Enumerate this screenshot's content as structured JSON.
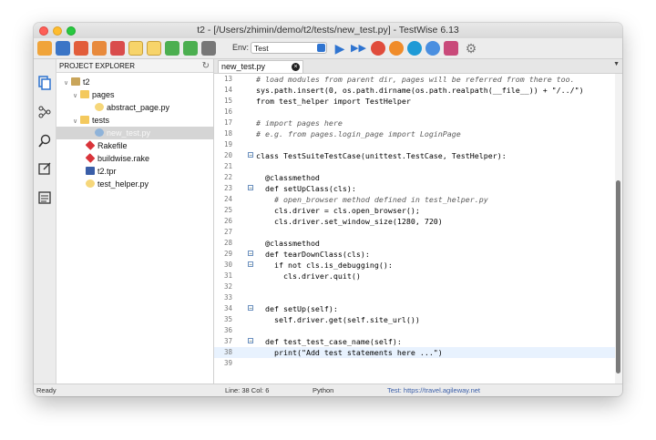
{
  "window": {
    "title": "t2 - [/Users/zhimin/demo/t2/tests/new_test.py] - TestWise 6.13"
  },
  "toolbar": {
    "env_label": "Env:",
    "env_value": "Test",
    "icons": [
      "new-file-icon",
      "save-icon",
      "undo-icon",
      "redo-icon",
      "cut-icon",
      "copy-icon",
      "paste-icon",
      "refresh-icon",
      "check-icon",
      "outline-icon",
      "run-icon",
      "run-all-icon",
      "chrome-icon",
      "firefox-icon",
      "edge-icon",
      "safari-icon",
      "book-icon",
      "settings-icon"
    ]
  },
  "sidebar_icons": [
    "files-icon",
    "graph-icon",
    "search-icon",
    "note-icon",
    "list-icon"
  ],
  "explorer": {
    "title": "PROJECT EXPLORER",
    "items": [
      {
        "label": "t2"
      },
      {
        "label": "pages"
      },
      {
        "label": "abstract_page.py"
      },
      {
        "label": "tests"
      },
      {
        "label": "new_test.py"
      },
      {
        "label": "Rakefile"
      },
      {
        "label": "buildwise.rake"
      },
      {
        "label": "t2.tpr"
      },
      {
        "label": "test_helper.py"
      }
    ]
  },
  "editor": {
    "tab": "new_test.py",
    "lines": [
      {
        "n": "13",
        "t": "# load modules from parent dir, pages will be referred from there too."
      },
      {
        "n": "14",
        "t": "sys.path.insert(0, os.path.dirname(os.path.realpath(__file__)) + \"/../\")"
      },
      {
        "n": "15",
        "t": "from test_helper import TestHelper"
      },
      {
        "n": "16",
        "t": ""
      },
      {
        "n": "17",
        "t": "# import pages here"
      },
      {
        "n": "18",
        "t": "# e.g. from pages.login_page import LoginPage"
      },
      {
        "n": "19",
        "t": ""
      },
      {
        "n": "20",
        "t": "class TestSuiteTestCase(unittest.TestCase, TestHelper):"
      },
      {
        "n": "21",
        "t": ""
      },
      {
        "n": "22",
        "t": "  @classmethod"
      },
      {
        "n": "23",
        "t": "  def setUpClass(cls):"
      },
      {
        "n": "24",
        "t": "    # open_browser method defined in test_helper.py"
      },
      {
        "n": "25",
        "t": "    cls.driver = cls.open_browser();"
      },
      {
        "n": "26",
        "t": "    cls.driver.set_window_size(1280, 720)"
      },
      {
        "n": "27",
        "t": ""
      },
      {
        "n": "28",
        "t": "  @classmethod"
      },
      {
        "n": "29",
        "t": "  def tearDownClass(cls):"
      },
      {
        "n": "30",
        "t": "    if not cls.is_debugging():"
      },
      {
        "n": "31",
        "t": "      cls.driver.quit()"
      },
      {
        "n": "32",
        "t": ""
      },
      {
        "n": "33",
        "t": ""
      },
      {
        "n": "34",
        "t": "  def setUp(self):"
      },
      {
        "n": "35",
        "t": "    self.driver.get(self.site_url())"
      },
      {
        "n": "36",
        "t": ""
      },
      {
        "n": "37",
        "t": "  def test_test_case_name(self):"
      },
      {
        "n": "38",
        "t": "    print(\"Add test statements here ...\")"
      },
      {
        "n": "39",
        "t": ""
      }
    ]
  },
  "status": {
    "left": "Ready",
    "position": "Line: 38  Col: 6",
    "language": "Python",
    "url": "Test: https://travel.agileway.net"
  }
}
